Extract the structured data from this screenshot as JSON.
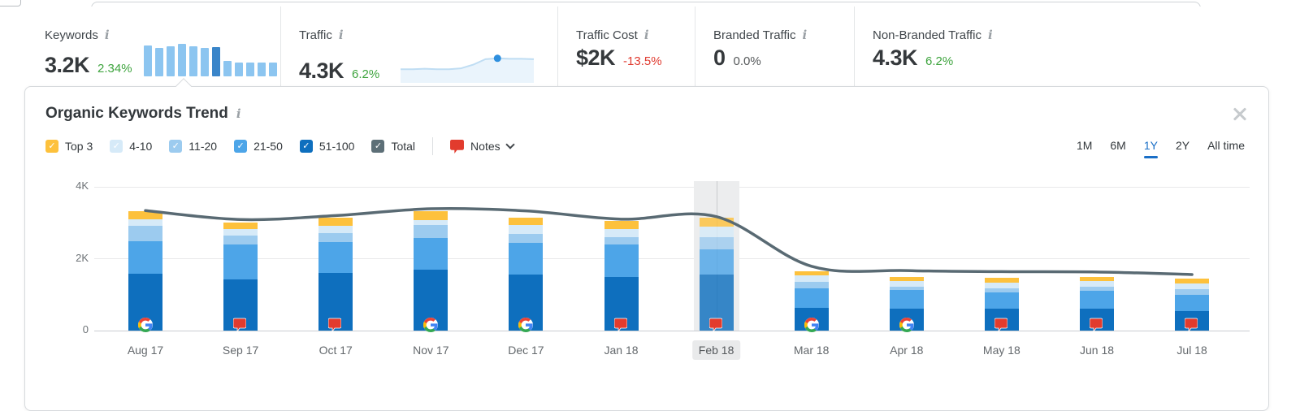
{
  "icons": {
    "info": "i",
    "close": "close-x",
    "chevron": "chevron-down",
    "note": "notes-bubble",
    "google": "google-g"
  },
  "metrics": [
    {
      "label": "Keywords",
      "value": "3.2K",
      "delta": "2.34%",
      "delta_color": "green",
      "spark": "bars"
    },
    {
      "label": "Traffic",
      "value": "4.3K",
      "delta": "6.2%",
      "delta_color": "green",
      "spark": "line"
    },
    {
      "label": "Traffic Cost",
      "value": "$2K",
      "delta": "-13.5%",
      "delta_color": "red"
    },
    {
      "label": "Branded Traffic",
      "value": "0",
      "delta": "0.0%",
      "delta_color": "neutral"
    },
    {
      "label": "Non-Branded Traffic",
      "value": "4.3K",
      "delta": "6.2%",
      "delta_color": "green"
    }
  ],
  "sparklines": {
    "keywords": {
      "values": [
        95,
        87,
        93,
        100,
        93,
        88,
        90,
        47,
        43,
        42,
        43,
        42
      ],
      "highlight_index": 6
    },
    "traffic": {
      "values": [
        30,
        30,
        31,
        30,
        30,
        32,
        40,
        52,
        54,
        53,
        53,
        52
      ],
      "dot_index": 8
    }
  },
  "panel": {
    "title": "Organic Keywords Trend",
    "notes_label": "Notes",
    "legend": [
      {
        "label": "Top 3",
        "color": "#FDC13C"
      },
      {
        "label": "4-10",
        "color": "#D6EAF8"
      },
      {
        "label": "11-20",
        "color": "#9CCBEF"
      },
      {
        "label": "21-50",
        "color": "#4DA5E8"
      },
      {
        "label": "51-100",
        "color": "#0E6FBE"
      },
      {
        "label": "Total",
        "color": "#5D6F77"
      }
    ],
    "ranges": [
      {
        "label": "1M",
        "active": false
      },
      {
        "label": "6M",
        "active": false
      },
      {
        "label": "1Y",
        "active": true
      },
      {
        "label": "2Y",
        "active": false
      },
      {
        "label": "All time",
        "active": false
      }
    ]
  },
  "chart_data": {
    "type": "bar",
    "subtype": "stacked-bars-with-total-line",
    "title": "Organic Keywords Trend",
    "categories": [
      "Aug 17",
      "Sep 17",
      "Oct 17",
      "Nov 17",
      "Dec 17",
      "Jan 18",
      "Feb 18",
      "Mar 18",
      "Apr 18",
      "May 18",
      "Jun 18",
      "Jul 18"
    ],
    "series": [
      {
        "name": "51-100",
        "color": "#0E6FBE",
        "values": [
          1580,
          1430,
          1610,
          1700,
          1570,
          1490,
          1550,
          630,
          620,
          600,
          620,
          550
        ]
      },
      {
        "name": "21-50",
        "color": "#4DA5E8",
        "values": [
          900,
          960,
          860,
          880,
          880,
          900,
          700,
          550,
          500,
          460,
          480,
          450
        ]
      },
      {
        "name": "11-20",
        "color": "#9CCBEF",
        "values": [
          430,
          260,
          240,
          350,
          240,
          220,
          350,
          170,
          110,
          110,
          120,
          150
        ]
      },
      {
        "name": "4-10",
        "color": "#D6EAF8",
        "values": [
          190,
          180,
          200,
          150,
          240,
          220,
          300,
          180,
          150,
          160,
          150,
          160
        ]
      },
      {
        "name": "Top 3",
        "color": "#FDC13C",
        "values": [
          220,
          180,
          240,
          240,
          220,
          220,
          240,
          130,
          120,
          140,
          130,
          140
        ]
      }
    ],
    "total_line": {
      "name": "Total",
      "color": "#596a73",
      "values": [
        3340,
        3090,
        3200,
        3390,
        3330,
        3100,
        3170,
        1790,
        1670,
        1640,
        1630,
        1560
      ]
    },
    "marker_icons": [
      "google",
      "notes",
      "notes",
      "google",
      "google",
      "notes",
      "notes",
      "google",
      "google",
      "notes",
      "notes",
      "notes"
    ],
    "highlight_index": 6,
    "ylim": [
      0,
      4000
    ],
    "ylabels": [
      "4K",
      "2K",
      "0"
    ],
    "grid": true,
    "legend_position": "top-left"
  }
}
